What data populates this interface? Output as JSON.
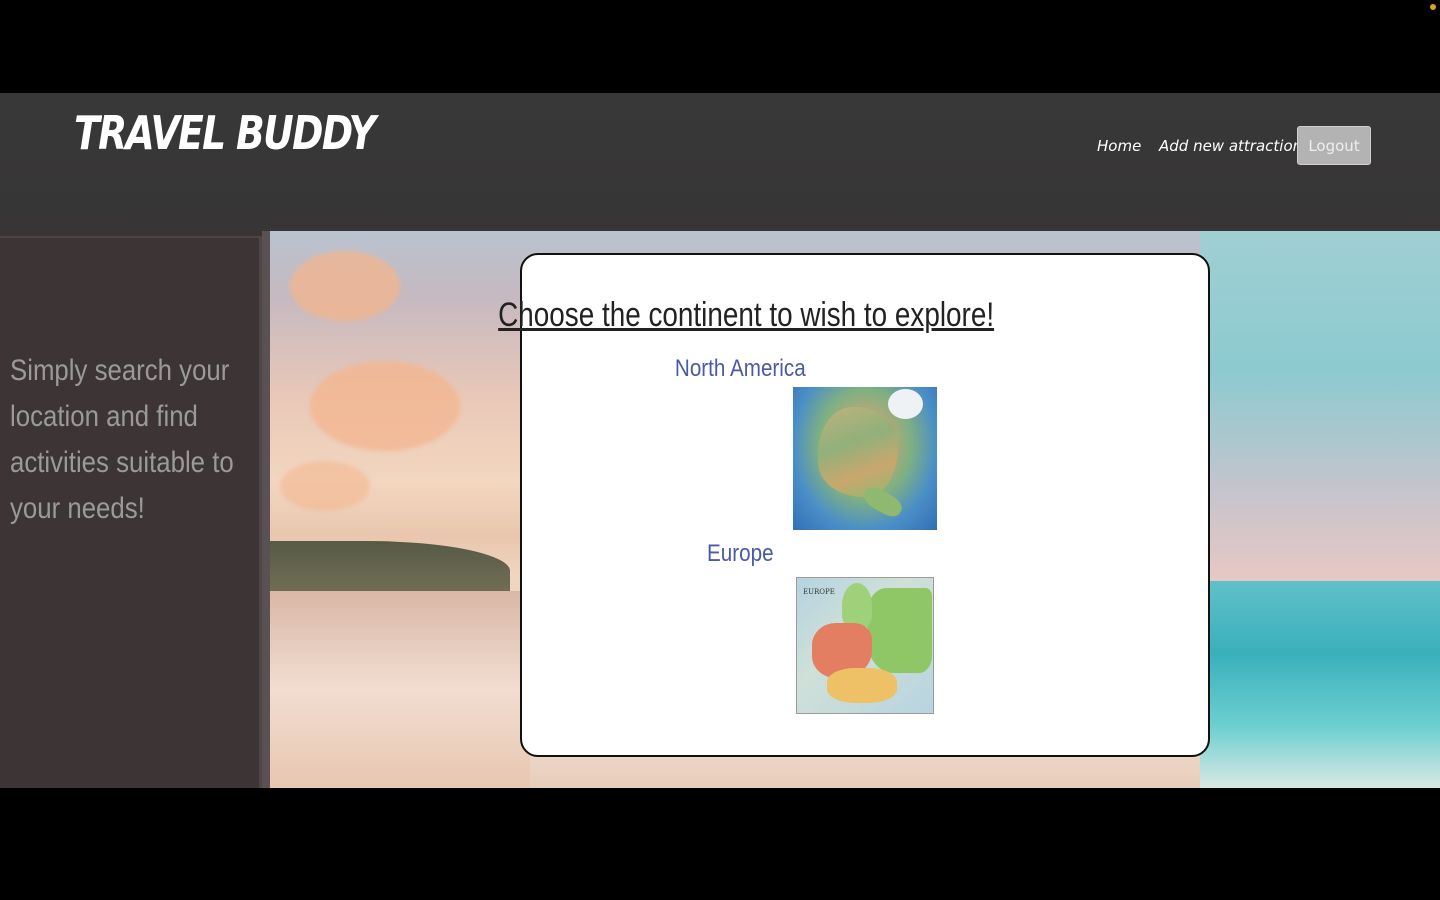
{
  "header": {
    "brand": "TRAVEL BUDDY",
    "nav": {
      "home": "Home",
      "add_attraction": "Add new attraction",
      "logout": "Logout"
    }
  },
  "sidebar": {
    "tagline": "Simply search your location and find activities suitable to your needs!"
  },
  "card": {
    "title": "Choose the continent to wish to explore!",
    "continents": [
      {
        "name": "North America",
        "icon": "north-america-map"
      },
      {
        "name": "Europe",
        "icon": "europe-map",
        "map_caption": "EUROPE"
      }
    ]
  },
  "colors": {
    "navbar": "#383838",
    "link": "#4b5aa6",
    "logout_bg": "#b3b3b3"
  }
}
